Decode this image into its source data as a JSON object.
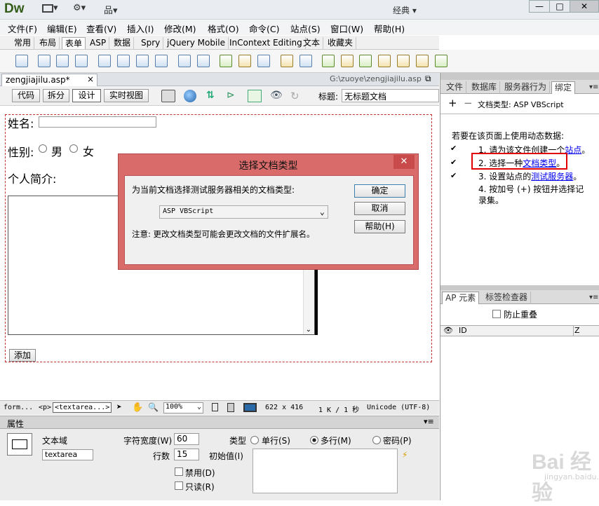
{
  "app": {
    "logo": "Dw",
    "workspace": "经典 ▾"
  },
  "title_tools": {
    "layout": "▾",
    "settings": "⚙▾",
    "site": "品▾"
  },
  "window": {
    "minimize": "—",
    "maximize": "□",
    "close": "✕"
  },
  "menu": [
    "文件(F)",
    "编辑(E)",
    "查看(V)",
    "插入(I)",
    "修改(M)",
    "格式(O)",
    "命令(C)",
    "站点(S)",
    "窗口(W)",
    "帮助(H)"
  ],
  "insert_tabs": [
    "常用",
    "布局",
    "表单",
    "ASP",
    "数据",
    "Spry",
    "jQuery Mobile",
    "InContext Editing",
    "文本",
    "收藏夹"
  ],
  "insert_active": "表单",
  "doc": {
    "tab": "zengjiajilu.asp*",
    "tab_close": "×",
    "path": "G:\\zuoye\\zengjiajilu.asp",
    "restore": "⧉"
  },
  "views": {
    "code": "代码",
    "split": "拆分",
    "design": "设计",
    "live": "实时视图"
  },
  "title_field": {
    "label": "标题:",
    "value": "无标题文档"
  },
  "form": {
    "name_label": "姓名:",
    "gender_label": "性别:",
    "male": "男",
    "female": "女",
    "intro_label": "个人简介:",
    "submit": "添加"
  },
  "status": {
    "tags": "form...",
    "tag_p": "<p>",
    "tag_textarea": "<textarea...>",
    "zoom": "100%",
    "size": "622 x 416",
    "filesize": "1 K / 1 秒",
    "encoding": "Unicode (UTF-8)"
  },
  "props": {
    "header": "属性",
    "element": "文本域",
    "name_value": "textarea",
    "char_width_label": "字符宽度(W)",
    "char_width_value": "60",
    "rows_label": "行数",
    "rows_value": "15",
    "type_label": "类型",
    "single": "单行(S)",
    "multi": "多行(M)",
    "password": "密码(P)",
    "init_label": "初始值(I)",
    "disabled": "禁用(D)",
    "readonly": "只读(R)"
  },
  "right_panel": {
    "tabs": [
      "文件",
      "数据库",
      "服务器行为",
      "绑定"
    ],
    "active_tab": "绑定",
    "add": "+",
    "remove": "−",
    "doctype": "文档类型: ASP VBScript",
    "intro": "若要在该页面上使用动态数据:",
    "step1_prefix": "1. 请为该文件创建一个",
    "step1_link": "站点",
    "step1_suffix": "。",
    "step2_prefix": "2. 选择一种",
    "step2_link": "文档类型",
    "step2_suffix": "。",
    "step3_prefix": "3. 设置站点的",
    "step3_link": "测试服务器",
    "step3_suffix": "。",
    "step4": "4. 按加号 (+) 按钮并选择记录集。",
    "ap_tabs": [
      "AP 元素",
      "标签检查器"
    ],
    "prevent_overlap": "防止重叠",
    "col_id": "ID",
    "col_z": "Z"
  },
  "dialog": {
    "title": "选择文档类型",
    "prompt": "为当前文档选择测试服务器相关的文档类型:",
    "select_value": "ASP VBScript",
    "note": "注意: 更改文档类型可能会更改文档的文件扩展名。",
    "ok": "确定",
    "cancel": "取消",
    "help": "帮助(H)"
  },
  "watermark": {
    "brand": "Bai 经验",
    "url": "jingyan.baidu.com"
  }
}
